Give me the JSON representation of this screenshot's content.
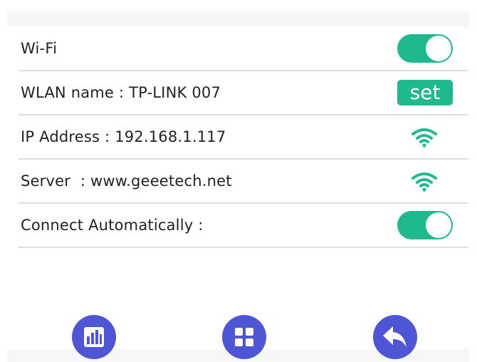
{
  "settings": {
    "wifi": {
      "label": "Wi-Fi",
      "enabled": true
    },
    "wlan": {
      "label": "WLAN name : TP-LINK 007",
      "button_label": "set"
    },
    "ip": {
      "label": "IP Address : 192.168.1.117",
      "icon": "wifi-signal-icon"
    },
    "server": {
      "label": "Server  : www.geeetech.net",
      "icon": "wifi-signal-icon"
    },
    "auto_connect": {
      "label": "Connect Automatically :",
      "enabled": true
    }
  },
  "nav": {
    "icons": [
      "bar-chart-icon",
      "grid-menu-icon",
      "back-arrow-icon"
    ]
  },
  "colors": {
    "accent": "#1fb98f",
    "nav": "#4f56d6",
    "divider": "#dcdfe2"
  }
}
